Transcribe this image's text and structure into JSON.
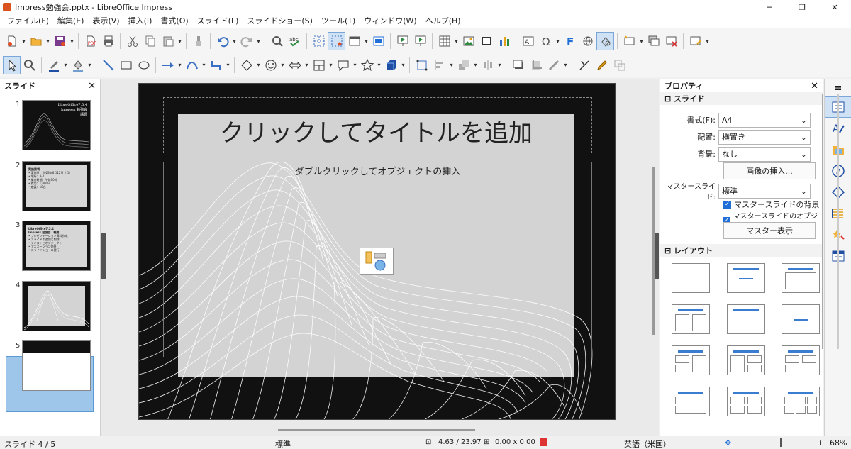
{
  "window": {
    "title": "Impress勉強会.pptx - LibreOffice Impress",
    "minimize": "─",
    "maximize": "❐",
    "close": "✕"
  },
  "menu": [
    "ファイル(F)",
    "編集(E)",
    "表示(V)",
    "挿入(I)",
    "書式(O)",
    "スライド(L)",
    "スライドショー(S)",
    "ツール(T)",
    "ウィンドウ(W)",
    "ヘルプ(H)"
  ],
  "slides_panel": {
    "title": "スライド",
    "close": "✕",
    "thumbs": [
      {
        "num": "1",
        "title": "LibreOffice7.5.4",
        "subtitle": "Impress 勉強会",
        "author": "講師"
      },
      {
        "num": "2",
        "title": "実施要項",
        "lines": [
          "• 実施日：2023年6月12日（月）",
          "• 場所：A-2",
          "• 集合時間：午前10時",
          "• 費用：1,000円",
          "• 定員：10名"
        ]
      },
      {
        "num": "3",
        "title": "LibreOffice7.5.4",
        "subtitle": "Impress 勉強会　概要",
        "lines": [
          "• プレゼンテーション資料作成",
          "• スライドの追加と削除",
          "• テキストとオブジェクト",
          "• アニメーション効果",
          "• スライドショーの実行"
        ]
      },
      {
        "num": "4"
      },
      {
        "num": "5"
      }
    ]
  },
  "slide": {
    "title_placeholder": "クリックしてタイトルを追加",
    "content_placeholder": "ダブルクリックしてオブジェクトの挿入"
  },
  "properties": {
    "title": "プロパティ",
    "close": "✕",
    "menu": "≡",
    "slide_section": "スライド",
    "format_label": "書式(F):",
    "format_value": "A4",
    "orientation_label": "配置:",
    "orientation_value": "横置き",
    "background_label": "背景:",
    "background_value": "なし",
    "insert_image": "画像の挿入...",
    "master_label": "マスタースライド:",
    "master_value": "標準",
    "master_bg": "マスタースライドの背景",
    "master_obj": "マスタースライドのオブジェクト",
    "master_view": "マスター表示",
    "layout_section": "レイアウト"
  },
  "status": {
    "slide_pos": "スライド 4 / 5",
    "master": "標準",
    "position": "4.63 / 23.97",
    "size": "0.00 x 0.00",
    "language": "英語（米国）",
    "zoom": "68%",
    "zoom_minus": "−",
    "zoom_plus": "+"
  },
  "colors": {
    "accent": "#1f6fd6",
    "selection": "#9ec5ea",
    "slide_bg": "#111111"
  }
}
